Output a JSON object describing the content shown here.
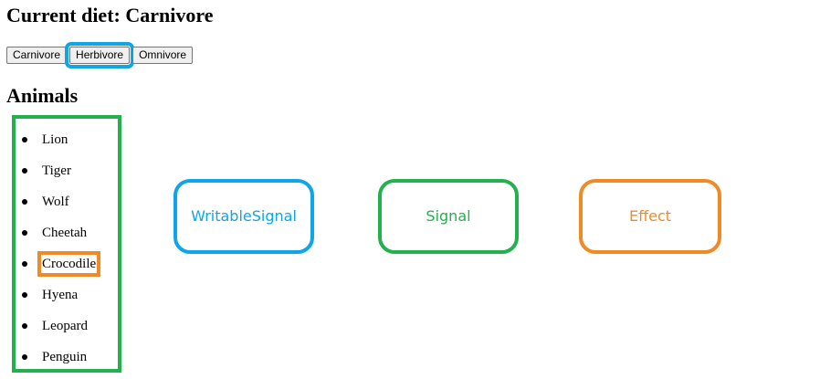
{
  "title": "Current diet: Carnivore",
  "buttons": [
    {
      "label": "Carnivore",
      "highlighted": false
    },
    {
      "label": "Herbivore",
      "highlighted": true
    },
    {
      "label": "Omnivore",
      "highlighted": false
    }
  ],
  "section_title": "Animals",
  "animals": [
    "Lion",
    "Tiger",
    "Wolf",
    "Cheetah",
    "Crocodile",
    "Hyena",
    "Leopard",
    "Penguin"
  ],
  "highlighted_animal_index": 4,
  "signals": {
    "writable_label": "WritableSignal",
    "signal_label": "Signal",
    "effect_label": "Effect"
  },
  "colors": {
    "writable": "#0ea5e9",
    "signal": "#22b14c",
    "effect": "#f08a24"
  }
}
